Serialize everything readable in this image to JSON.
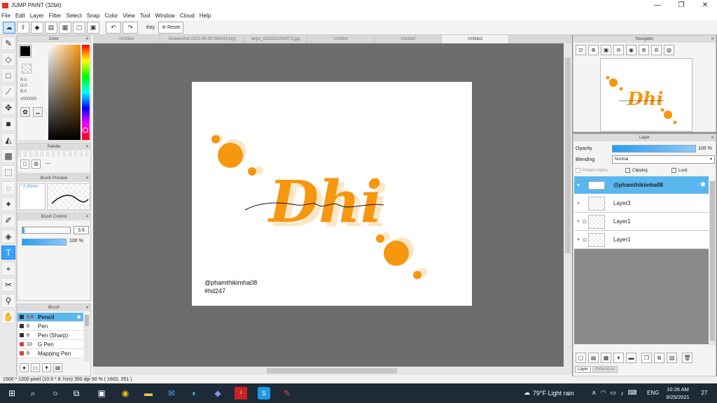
{
  "window": {
    "title": "JUMP PAINT (32bit)"
  },
  "menu": [
    "File",
    "Edit",
    "Layer",
    "Filter",
    "Select",
    "Snap",
    "Color",
    "View",
    "Tool",
    "Window",
    "Cloud",
    "Help"
  ],
  "optbar": {
    "key_label": "Key",
    "reset_label": "Reset"
  },
  "color_panel": {
    "title": "Color",
    "r": "R:0",
    "g": "G:0",
    "b": "B:0",
    "hex": "#000000"
  },
  "palette_panel": {
    "title": "Palette",
    "value": "---"
  },
  "brush_preview": {
    "title": "Brush Preview",
    "size": "0.20mm"
  },
  "brush_control": {
    "title": "Brush Control",
    "size": "3.6",
    "opacity": "100 %"
  },
  "brush_list": {
    "title": "Brush",
    "items": [
      {
        "size": "3.6",
        "name": "Pencil",
        "selected": true,
        "color": "#333333"
      },
      {
        "size": "8",
        "name": "Pen",
        "selected": false,
        "color": "#333333"
      },
      {
        "size": "8",
        "name": "Pen (Sharp)",
        "selected": false,
        "color": "#333333"
      },
      {
        "size": "10",
        "name": "G Pen",
        "selected": false,
        "color": "#e03a3a"
      },
      {
        "size": "8",
        "name": "Mapping Pen",
        "selected": false,
        "color": "#e03a3a"
      }
    ]
  },
  "tabs": [
    "Untitled",
    "Screenshot 2021-09-25 094243.png",
    "large_1632531094073.jpg",
    "Untitled",
    "Untitled",
    "Untitled"
  ],
  "artwork": {
    "title_text": "Dhi",
    "handle": "@phamthikimha08",
    "hashtag": "#hd247",
    "accent": "#f7960f",
    "accent_light": "#fde6c6"
  },
  "navigator": {
    "title": "Navigator"
  },
  "layer_panel": {
    "title": "Layer",
    "opacity_label": "Opacity",
    "opacity_value": "100 %",
    "blending_label": "Blending",
    "blending_value": "Normal",
    "protect_alpha": "Protect Alpha",
    "clipping": "Clipping",
    "lock": "Lock",
    "layers": [
      {
        "name": "@phamthikimha08",
        "selected": true
      },
      {
        "name": "Layer3",
        "selected": false
      },
      {
        "name": "Layer1",
        "selected": false
      },
      {
        "name": "Layer1",
        "selected": false
      }
    ],
    "tab_layer": "Layer",
    "tab_reference": "Reference"
  },
  "status": {
    "text": "1500 * 1200 pixel  (10.9 * 8.7cm)  350 dpi  50 %  ( 1602, 251 )"
  },
  "taskbar": {
    "weather": "79°F  Light rain",
    "lang": "ENG",
    "time": "10:26 AM",
    "date": "9/25/2021",
    "notif_count": "27"
  }
}
